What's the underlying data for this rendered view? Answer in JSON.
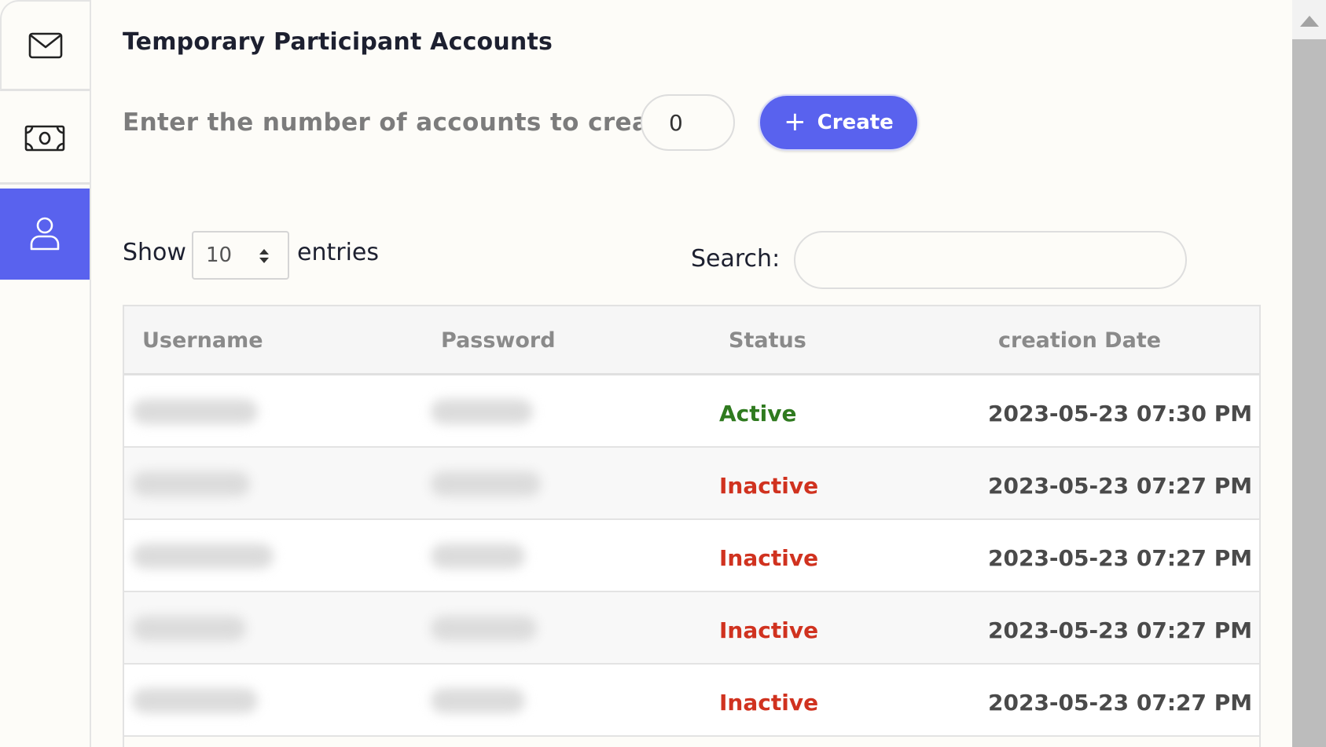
{
  "sidebar": {
    "items": [
      {
        "icon": "envelope-icon",
        "active": false
      },
      {
        "icon": "money-icon",
        "active": false
      },
      {
        "icon": "user-icon",
        "active": true
      }
    ],
    "active_color": "#5962ee"
  },
  "page": {
    "title": "Temporary Participant Accounts",
    "create_label": "Enter the number of accounts to create",
    "count_value": "0",
    "create_button": "Create",
    "button_color": "#5962ee"
  },
  "table_controls": {
    "show_label": "Show",
    "entries_value": "10",
    "entries_label": "entries",
    "search_label": "Search:",
    "search_value": ""
  },
  "table": {
    "columns": [
      "Username",
      "Password",
      "Status",
      "creation Date"
    ],
    "rows": [
      {
        "status": "Active",
        "date": "2023-05-23 07:30 PM"
      },
      {
        "status": "Inactive",
        "date": "2023-05-23 07:27 PM"
      },
      {
        "status": "Inactive",
        "date": "2023-05-23 07:27 PM"
      },
      {
        "status": "Inactive",
        "date": "2023-05-23 07:27 PM"
      },
      {
        "status": "Inactive",
        "date": "2023-05-23 07:27 PM"
      }
    ],
    "status_colors": {
      "Active": "#2f7a1f",
      "Inactive": "#d0321f"
    }
  }
}
